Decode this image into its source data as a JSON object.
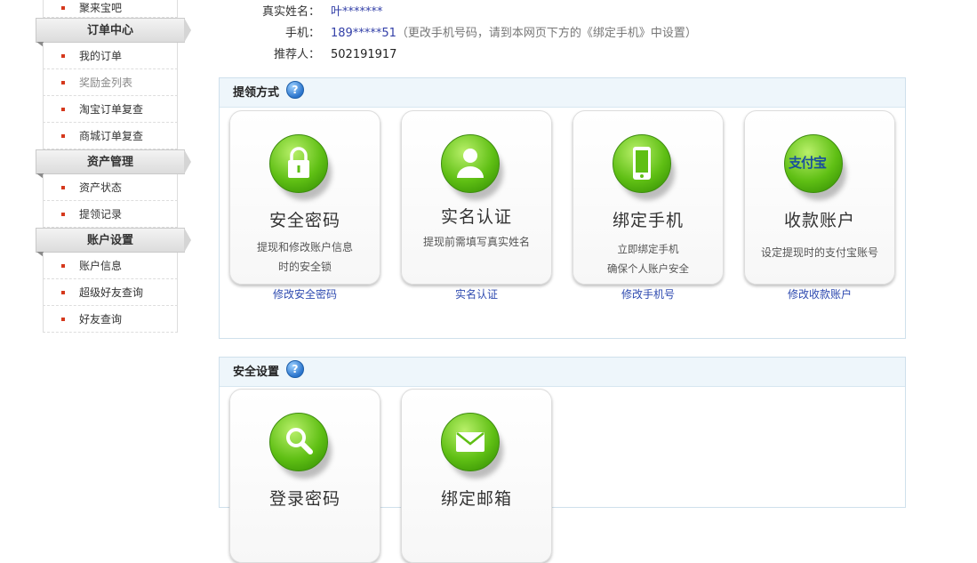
{
  "sidebar": {
    "top_item": "聚来宝吧",
    "sections": [
      {
        "title": "订单中心",
        "items": [
          {
            "label": "我的订单",
            "muted": false
          },
          {
            "label": "奖励金列表",
            "muted": true
          },
          {
            "label": "淘宝订单复查",
            "muted": false
          },
          {
            "label": "商城订单复查",
            "muted": false
          }
        ]
      },
      {
        "title": "资产管理",
        "items": [
          {
            "label": "资产状态",
            "muted": false
          },
          {
            "label": "提领记录",
            "muted": false
          }
        ]
      },
      {
        "title": "账户设置",
        "items": [
          {
            "label": "账户信息",
            "muted": false
          },
          {
            "label": "超级好友查询",
            "muted": false
          },
          {
            "label": "好友查询",
            "muted": false
          }
        ]
      }
    ]
  },
  "info": {
    "name_label": "真实姓名：",
    "name_value": "叶*******",
    "phone_label": "手机：",
    "phone_value": "189*****51",
    "phone_note": "（更改手机号码，请到本网页下方的《绑定手机》中设置）",
    "referrer_label": "推荐人：",
    "referrer_value": "502191917"
  },
  "withdraw_panel": {
    "title": "提领方式",
    "help": "?",
    "cards": [
      {
        "icon": "lock-icon",
        "title": "安全密码",
        "desc1": "提现和修改账户信息",
        "desc2": "时的安全锁",
        "link": "修改安全密码"
      },
      {
        "icon": "person-icon",
        "title": "实名认证",
        "desc1": "提现前需填写真实姓名",
        "desc2": "",
        "link": "实名认证"
      },
      {
        "icon": "phone-icon",
        "title": "绑定手机",
        "desc1": "立即绑定手机",
        "desc2": "确保个人账户安全",
        "link": "修改手机号"
      },
      {
        "icon": "alipay-icon",
        "title": "收款账户",
        "desc1": "设定提现时的支付宝账号",
        "desc2": "",
        "link": "修改收款账户",
        "logo_text": "支付宝"
      }
    ]
  },
  "security_panel": {
    "title": "安全设置",
    "help": "?",
    "cards": [
      {
        "icon": "search-icon",
        "title": "登录密码"
      },
      {
        "icon": "mail-icon",
        "title": "绑定邮箱"
      }
    ]
  },
  "colors": {
    "accent_green": "#5fbf14",
    "link_blue": "#2f4bb0",
    "panel_head": "#eef6fb",
    "bullet_red": "#d5381c"
  }
}
